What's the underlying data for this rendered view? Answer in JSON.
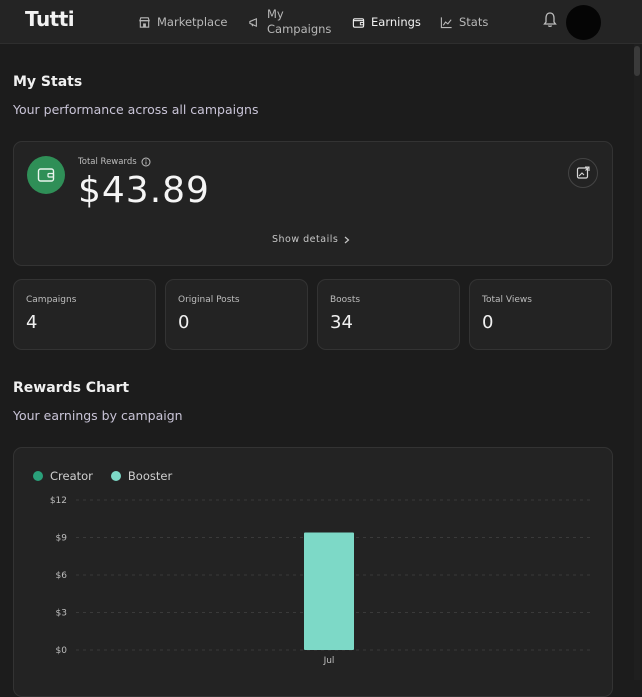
{
  "nav": {
    "logo": "Tutti",
    "items": [
      {
        "label": "Marketplace"
      },
      {
        "label_line1": "My",
        "label_line2": "Campaigns"
      },
      {
        "label": "Earnings"
      },
      {
        "label": "Stats"
      }
    ]
  },
  "stats_section": {
    "title": "My Stats",
    "subtitle": "Your performance across all campaigns"
  },
  "rewards": {
    "label": "Total Rewards",
    "amount": "$43.89",
    "show_details": "Show details",
    "accent": "#2f8f57"
  },
  "stat_cards": [
    {
      "label": "Campaigns",
      "value": "4"
    },
    {
      "label": "Original Posts",
      "value": "0"
    },
    {
      "label": "Boosts",
      "value": "34"
    },
    {
      "label": "Total Views",
      "value": "0"
    }
  ],
  "chart_section": {
    "title": "Rewards Chart",
    "subtitle": "Your earnings by campaign"
  },
  "chart_data": {
    "type": "bar",
    "categories": [
      "Jul"
    ],
    "series": [
      {
        "name": "Creator",
        "values": [
          0
        ],
        "color": "#2aa07a"
      },
      {
        "name": "Booster",
        "values": [
          9.4
        ],
        "color": "#7dd9c7"
      }
    ],
    "yticks": [
      "$0",
      "$3",
      "$6",
      "$9",
      "$12"
    ],
    "ylim": [
      0,
      12
    ],
    "grid": true,
    "legend": "top-left"
  }
}
